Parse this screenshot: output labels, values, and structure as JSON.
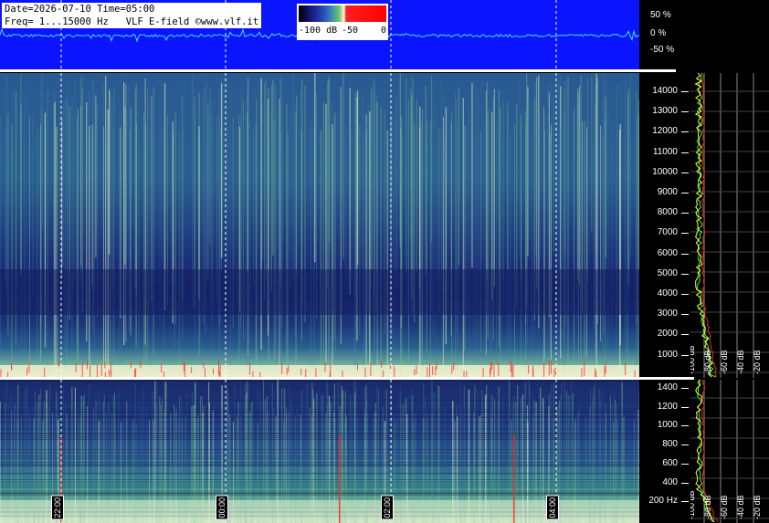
{
  "header": {
    "line1": "Date=2026-07-10 Time=05:00",
    "line2": "Freq= 1...15000 Hz   VLF E-field ©www.vlf.it"
  },
  "colorbar": {
    "labels": [
      "-100 dB",
      "-50",
      "0"
    ]
  },
  "waveform": {
    "scale_labels": [
      "50 %",
      "0 %",
      "-50 %"
    ]
  },
  "spectrogram_main": {
    "freq_ticks": [
      "14000",
      "13000",
      "12000",
      "11000",
      "10000",
      "9000",
      "8000",
      "7000",
      "6000",
      "5000",
      "4000",
      "3000",
      "2000",
      "1000"
    ],
    "level_labels": [
      "-100 dB",
      "-80 dB",
      "-60 dB",
      "-40 dB",
      "-20 dB"
    ]
  },
  "spectrogram_low": {
    "freq_ticks": [
      "1400",
      "1200",
      "1000",
      "800",
      "600",
      "400",
      "200 Hz"
    ],
    "level_labels": [
      "-100 dB",
      "-80 dB",
      "-60 dB",
      "-40 dB",
      "-20 dB"
    ]
  },
  "time_markers": [
    "22:00",
    "00:00",
    "02:00",
    "04:00"
  ],
  "colors": {
    "waveform_bg": "#0a14ff",
    "waveform_trace": "#40e0ff",
    "marker_line": "#ffffff",
    "level_red": "#ff2020",
    "level_green": "#20ff40",
    "level_yellow": "#ffff40"
  }
}
